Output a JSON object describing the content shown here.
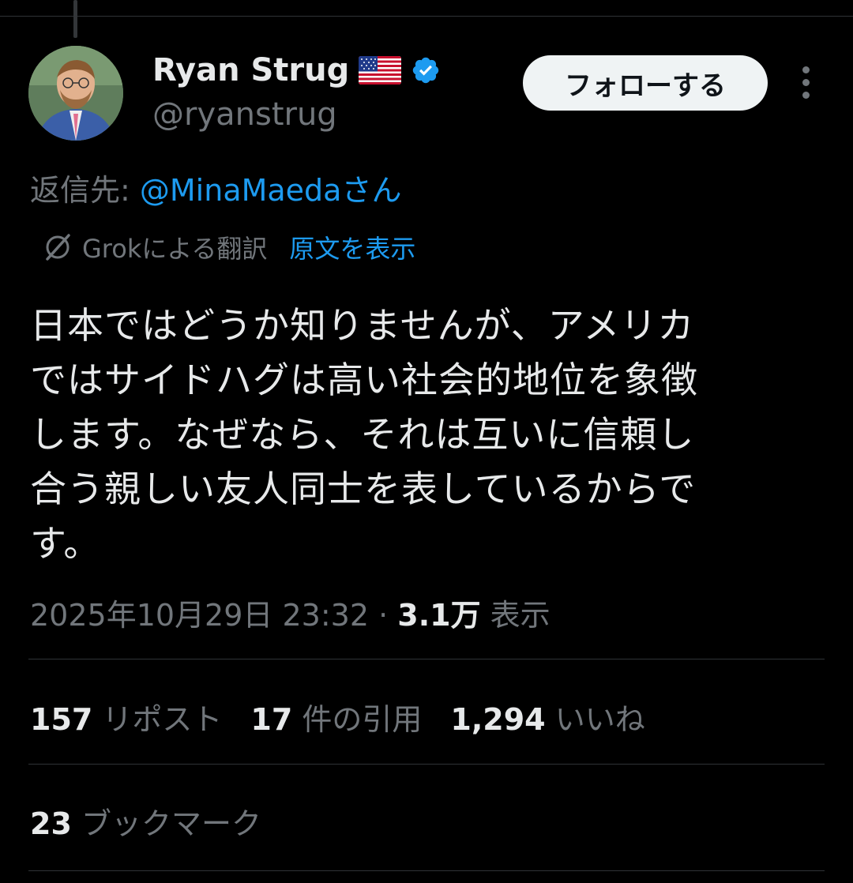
{
  "author": {
    "display_name": "Ryan Strug",
    "handle": "@ryanstrug",
    "flag_icon": "us-flag-icon",
    "verified_color": "#1d9bf0"
  },
  "header": {
    "follow_label": "フォローする"
  },
  "reply": {
    "prefix": "返信先: ",
    "mention": "@MinaMaedaさん"
  },
  "translation": {
    "label": "Grokによる翻訳",
    "show_original": "原文を表示"
  },
  "tweet": {
    "lines": [
      "日本ではどうか知りませんが、アメリカ",
      "ではサイドハグは高い社会的地位を象徴",
      "します。なぜなら、それは互いに信頼し",
      "合う親しい友人同士を表しているからで",
      "す。"
    ],
    "timestamp": "2025年10月29日 23:32",
    "separator": " · ",
    "views_count": "3.1万",
    "views_label": " 表示"
  },
  "stats": {
    "reposts_count": "157",
    "reposts_label": " リポスト",
    "quotes_count": "17",
    "quotes_label": " 件の引用",
    "likes_count": "1,294",
    "likes_label": " いいね",
    "bookmarks_count": "23",
    "bookmarks_label": " ブックマーク"
  },
  "colors": {
    "accent": "#1d9bf0",
    "background": "#000000",
    "muted_text": "#71767b"
  }
}
